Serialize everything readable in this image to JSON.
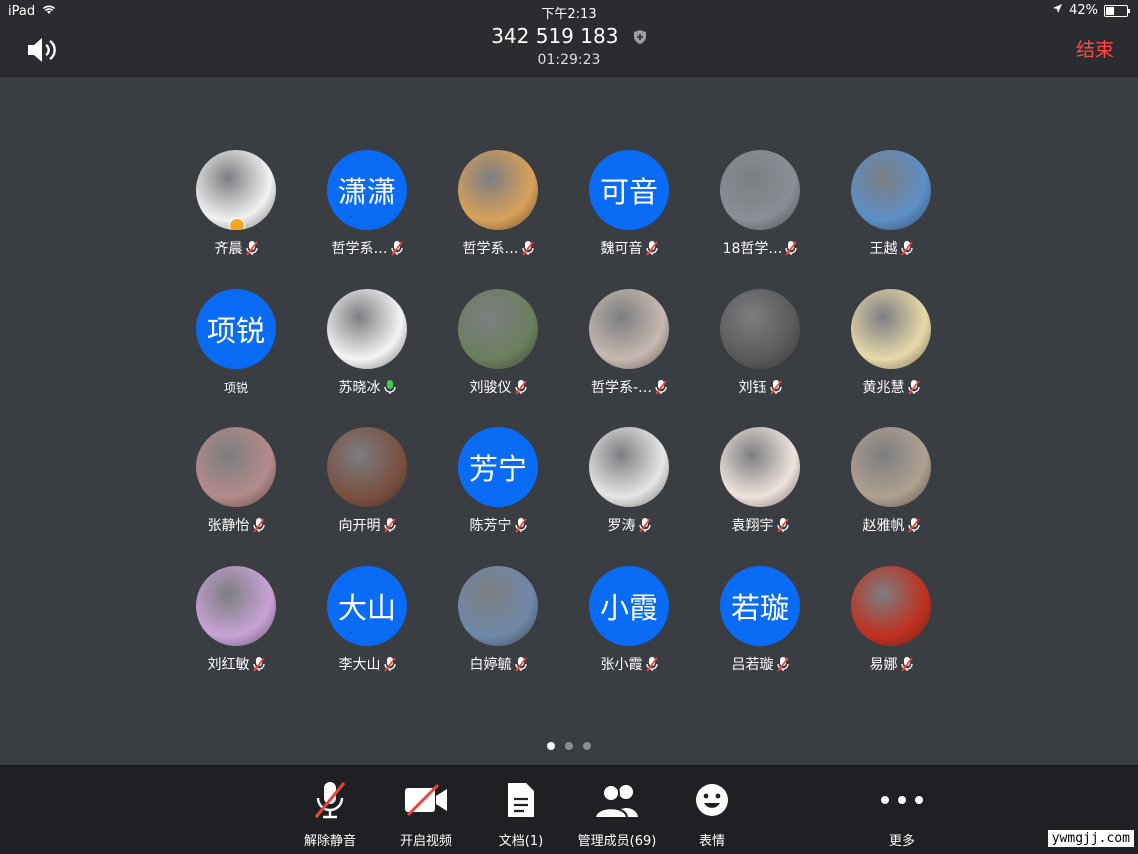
{
  "status": {
    "device": "iPad",
    "time": "下午2:13",
    "battery": "42%",
    "battery_level": 0.42
  },
  "header": {
    "meeting_id": "342 519 183",
    "timer": "01:29:23",
    "end_label": "结束"
  },
  "participants": [
    {
      "name": "齐晨",
      "avatar": "img",
      "color": "#f2f2f2",
      "mic": "muted",
      "host": true
    },
    {
      "name": "哲学系…",
      "avatar": "text",
      "text": "潇潇",
      "mic": "muted"
    },
    {
      "name": "哲学系…",
      "avatar": "img",
      "color": "#d9a15a",
      "mic": "muted"
    },
    {
      "name": "魏可音",
      "avatar": "text",
      "text": "可音",
      "mic": "muted"
    },
    {
      "name": "18哲学…",
      "avatar": "img",
      "color": "#8a8f96",
      "mic": "muted"
    },
    {
      "name": "王越",
      "avatar": "img",
      "color": "#5b8fc7",
      "mic": "muted"
    },
    {
      "name": "项锐",
      "avatar": "text",
      "text": "项锐",
      "mic": "none",
      "small": true
    },
    {
      "name": "苏晓冰",
      "avatar": "img",
      "color": "#f4f4f4",
      "mic": "active"
    },
    {
      "name": "刘骏仪",
      "avatar": "img",
      "color": "#6b7f5e",
      "mic": "muted"
    },
    {
      "name": "哲学系-…",
      "avatar": "img",
      "color": "#c7b9b0",
      "mic": "muted"
    },
    {
      "name": "刘钰",
      "avatar": "img",
      "color": "#5a5a5a",
      "mic": "muted"
    },
    {
      "name": "黄兆慧",
      "avatar": "img",
      "color": "#e8d9a8",
      "mic": "muted"
    },
    {
      "name": "张静怡",
      "avatar": "img",
      "color": "#b48a8a",
      "mic": "muted"
    },
    {
      "name": "向开明",
      "avatar": "img",
      "color": "#7a5040",
      "mic": "muted"
    },
    {
      "name": "陈芳宁",
      "avatar": "text",
      "text": "芳宁",
      "mic": "muted"
    },
    {
      "name": "罗涛",
      "avatar": "img",
      "color": "#e6e6e6",
      "mic": "muted"
    },
    {
      "name": "袁翔宇",
      "avatar": "img",
      "color": "#efe3dc",
      "mic": "muted"
    },
    {
      "name": "赵雅帆",
      "avatar": "img",
      "color": "#b0a090",
      "mic": "muted"
    },
    {
      "name": "刘红敏",
      "avatar": "img",
      "color": "#c9a3d6",
      "mic": "muted"
    },
    {
      "name": "李大山",
      "avatar": "text",
      "text": "大山",
      "mic": "muted"
    },
    {
      "name": "白婷毓",
      "avatar": "img",
      "color": "#6f88a8",
      "mic": "muted"
    },
    {
      "name": "张小霞",
      "avatar": "text",
      "text": "小霞",
      "mic": "muted"
    },
    {
      "name": "吕若璇",
      "avatar": "text",
      "text": "若璇",
      "mic": "muted"
    },
    {
      "name": "易娜",
      "avatar": "img",
      "color": "#c0301e",
      "mic": "muted"
    }
  ],
  "page_dots": {
    "count": 3,
    "active": 0
  },
  "toolbar": {
    "unmute": "解除静音",
    "video": "开启视频",
    "docs": "文档(1)",
    "members": "管理成员(69)",
    "emoji": "表情",
    "more": "更多"
  },
  "watermark": "ywmgjj.com",
  "colors": {
    "accent_blue": "#0a6cf4",
    "end_red": "#ff4a4a",
    "mic_active": "#3fcf4f",
    "mute_red": "#e8453c"
  }
}
